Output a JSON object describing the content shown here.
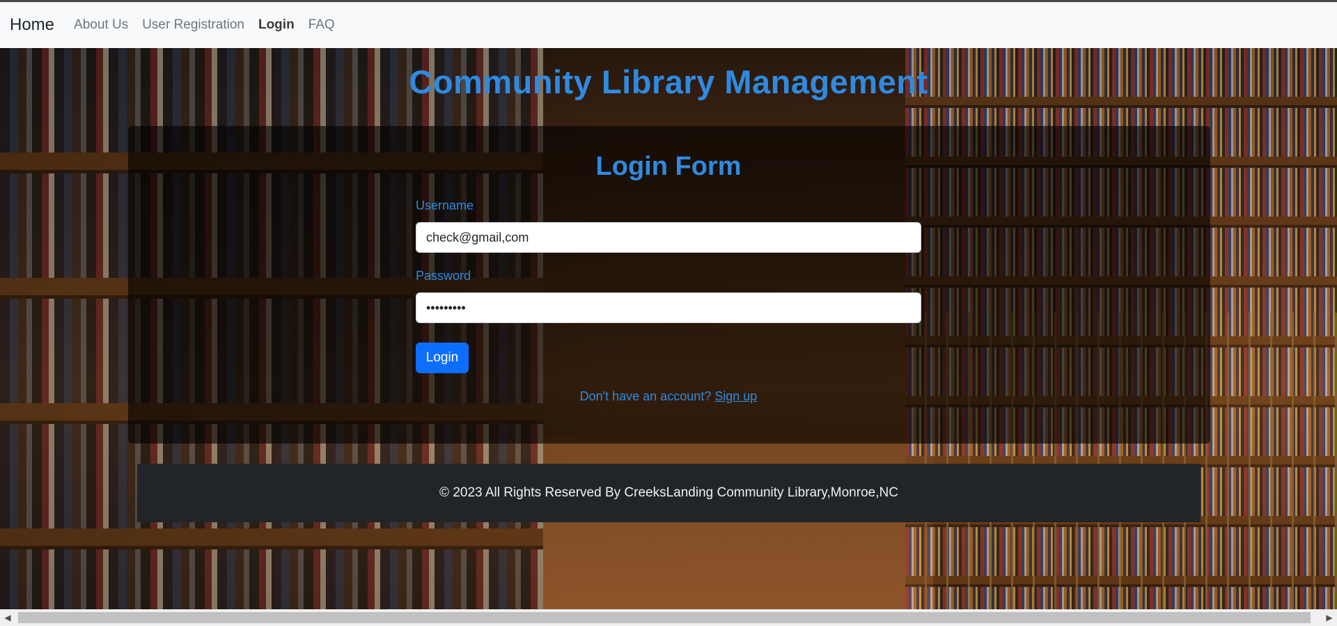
{
  "navbar": {
    "brand": "Home",
    "links": [
      "About Us",
      "User Registration",
      "Login",
      "FAQ"
    ],
    "active_index": 2
  },
  "site_title": "Community Library Management",
  "login_form": {
    "title": "Login Form",
    "username_label": "Username",
    "username_value": "check@gmail,com",
    "password_label": "Password",
    "password_value": "•••••••••",
    "submit_label": "Login",
    "signup_prompt": "Don't have an account?",
    "signup_link": "Sign up"
  },
  "footer": {
    "text": "© 2023 All Rights Reserved By CreeksLanding Community Library,Monroe,NC"
  },
  "scrollbar": {
    "left_arrow": "◀",
    "right_arrow": "▶"
  },
  "colors": {
    "accent": "#2f8ae0",
    "button": "#0d6efd",
    "navbar_bg": "#f8f9fa",
    "footer_bg": "#212529"
  }
}
